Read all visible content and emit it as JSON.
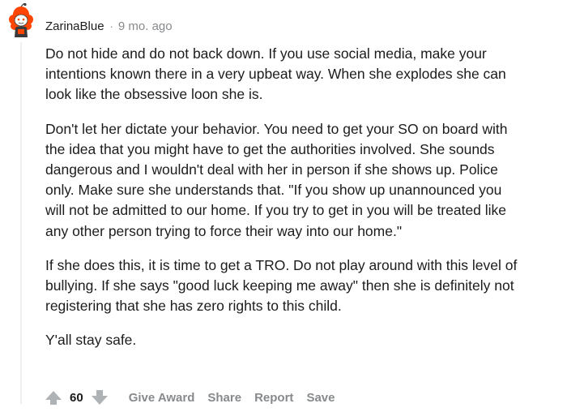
{
  "comment": {
    "author": "ZarinaBlue",
    "separator": "·",
    "age": "9 mo. ago",
    "paragraphs": [
      [
        "Do not hide and do not back down. If you use social media, make your",
        "intentions known there in a very upbeat way. When she explodes she can",
        "look like the obsessive loon she is."
      ],
      [
        "Don't let her dictate your behavior. You need to get your SO on board with",
        "the idea that you might have to get the authorities involved. She sounds",
        "dangerous and I wouldn't deal with her in person if she shows up. Police",
        "only. Make sure she understands that. \"If you show up unannounced you",
        "will not be admitted to our home. If you try to get in you will be treated like",
        "any other person trying to force their way into our home.\""
      ],
      [
        "If she does this, it is time to get a TRO. Do not play around with this level of",
        "bullying. If she says \"good luck keeping me away\" then she is definitely not",
        "registering that she has zero rights to this child."
      ],
      [
        "Y'all stay safe."
      ]
    ],
    "score": "60",
    "actions": {
      "give_award": "Give Award",
      "share": "Share",
      "report": "Report",
      "save": "Save"
    }
  },
  "icons": {
    "avatar": "snoo-avatar-icon",
    "upvote": "upvote-arrow-icon",
    "downvote": "downvote-arrow-icon"
  },
  "colors": {
    "meta_text": "#878a8c",
    "body_text": "#1c1c1c",
    "avatar_orange": "#ff4500",
    "thread_line": "#edeff1"
  }
}
